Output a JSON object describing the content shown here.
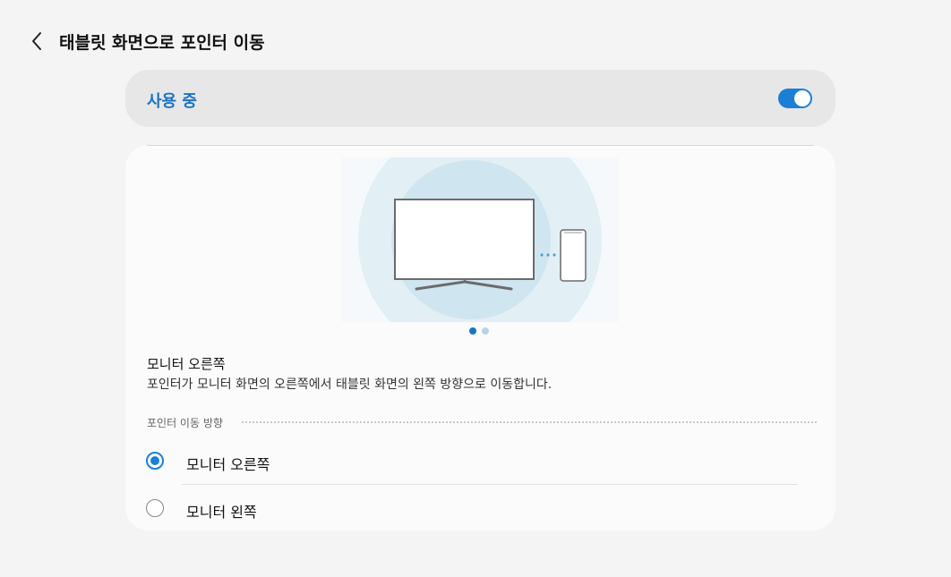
{
  "header": {
    "back_icon": "chevron-left-icon",
    "title": "태블릿 화면으로 포인터 이동"
  },
  "master_switch": {
    "label": "사용 중",
    "on": true,
    "accent": "#1b7fd6"
  },
  "illustration": {
    "icons": [
      "monitor-icon",
      "phone-icon",
      "connection-dots-icon"
    ],
    "pager": {
      "count": 2,
      "active": 1
    }
  },
  "description": {
    "title": "모니터 오른쪽",
    "body": "포인터가 모니터 화면의 오른쪽에서 태블릿 화면의 왼쪽 방향으로 이동합니다."
  },
  "direction_section": {
    "label": "포인터 이동 방향",
    "options": [
      {
        "label": "모니터 오른쪽",
        "selected": true
      },
      {
        "label": "모니터 왼쪽",
        "selected": false
      }
    ]
  },
  "colors": {
    "background": "#f4f4f4",
    "accent": "#1b7fd6",
    "accent_text": "#1a73c4"
  }
}
